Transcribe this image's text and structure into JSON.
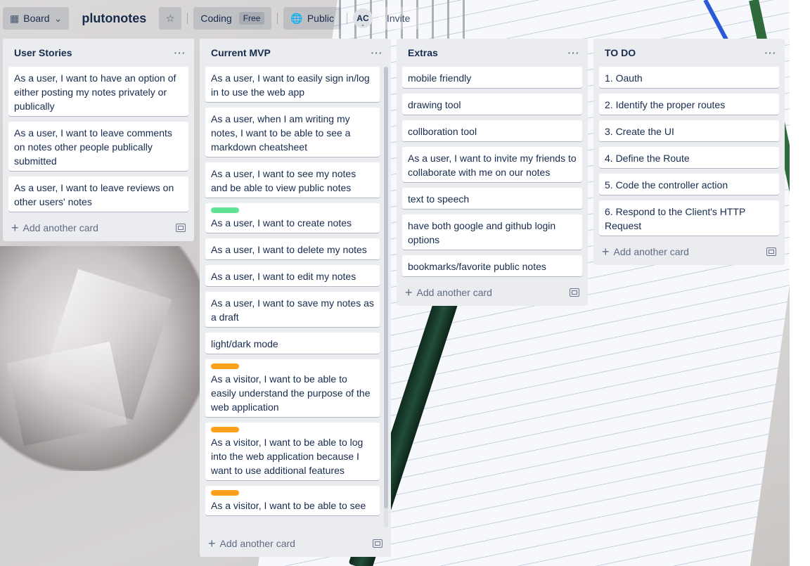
{
  "topbar": {
    "board_view_label": "Board",
    "board_title": "plutonotes",
    "workspace_label": "Coding",
    "workspace_badge": "Free",
    "visibility_label": "Public",
    "avatar_initials": "AC",
    "invite_label": "Invite"
  },
  "lists": [
    {
      "title": "User Stories",
      "cards": [
        {
          "text": "As a user, I want to have an option of either posting my notes privately or publically"
        },
        {
          "text": "As a user, I want to leave comments on notes other people publically submitted"
        },
        {
          "text": "As a user, I want to leave reviews on other users' notes"
        }
      ],
      "add_label": "Add another card"
    },
    {
      "title": "Current MVP",
      "cards": [
        {
          "text": "As a user, I want to easily sign in/log in to use the web app"
        },
        {
          "text": "As a user, when I am writing my notes, I want to be able to see a markdown cheatsheet"
        },
        {
          "text": "As a user, I want to see my notes and be able to view public notes"
        },
        {
          "text": "As a user, I want to create notes",
          "label_color": "#61e294"
        },
        {
          "text": "As a user, I want to delete my notes"
        },
        {
          "text": "As a user, I want to edit my notes"
        },
        {
          "text": "As a user, I want to save my notes as a draft"
        },
        {
          "text": "light/dark mode"
        },
        {
          "text": "As a visitor, I want to be able to easily understand the purpose of the web application",
          "label_color": "#ff9f1a"
        },
        {
          "text": "As a visitor, I want to be able to log into the web application because I want to use additional features",
          "label_color": "#ff9f1a"
        },
        {
          "text": "As a visitor, I want to be able to see",
          "label_color": "#ff9f1a"
        }
      ],
      "add_label": "Add another card"
    },
    {
      "title": "Extras",
      "cards": [
        {
          "text": "mobile friendly"
        },
        {
          "text": "drawing tool"
        },
        {
          "text": "collboration tool"
        },
        {
          "text": "As a user, I want to invite my friends to collaborate with me on our notes"
        },
        {
          "text": "text to speech"
        },
        {
          "text": "have both google and github login options"
        },
        {
          "text": "bookmarks/favorite public notes"
        }
      ],
      "add_label": "Add another card"
    },
    {
      "title": "TO DO",
      "cards": [
        {
          "text": "1. Oauth"
        },
        {
          "text": "2. Identify the proper routes"
        },
        {
          "text": "3. Create the UI"
        },
        {
          "text": "4. Define the Route"
        },
        {
          "text": "5. Code the controller action"
        },
        {
          "text": "6. Respond to the Client's HTTP Request"
        }
      ],
      "add_label": "Add another card"
    }
  ],
  "icons": {
    "board_view": "board-icon",
    "star": "star-icon",
    "visibility": "globe-icon",
    "list_menu": "ellipsis-icon",
    "add": "plus-icon",
    "template": "card-template-icon"
  }
}
